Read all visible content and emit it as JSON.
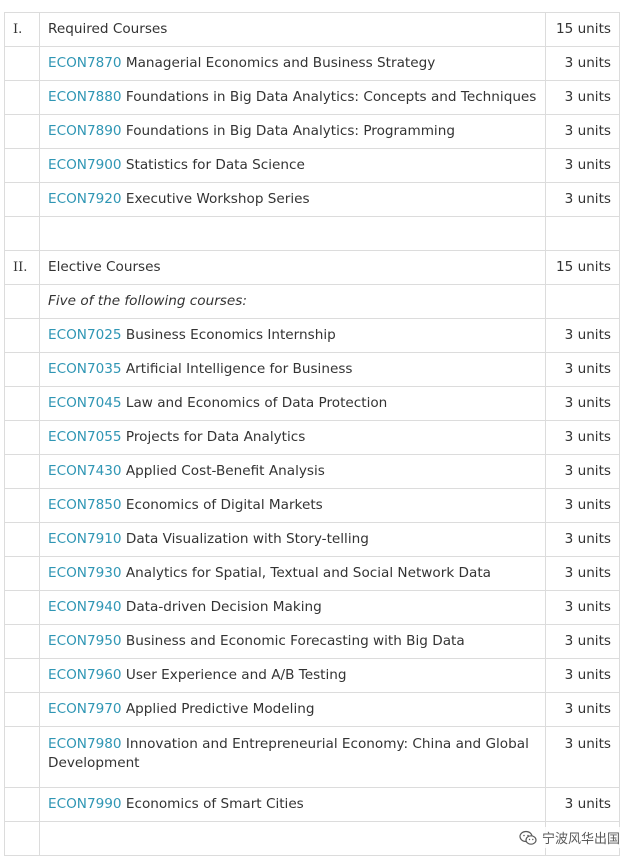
{
  "required": {
    "numeral": "I.",
    "title": "Required Courses",
    "units": "15 units",
    "courses": [
      {
        "code": "ECON7870",
        "name": "Managerial Economics and Business Strategy",
        "units": "3 units"
      },
      {
        "code": "ECON7880",
        "name": "Foundations in Big Data Analytics: Concepts and Techniques",
        "units": "3 units"
      },
      {
        "code": "ECON7890",
        "name": "Foundations in Big Data Analytics: Programming",
        "units": "3 units"
      },
      {
        "code": "ECON7900",
        "name": "Statistics for Data Science",
        "units": "3 units"
      },
      {
        "code": "ECON7920",
        "name": "Executive Workshop Series",
        "units": "3 units"
      }
    ]
  },
  "elective": {
    "numeral": "II.",
    "title": "Elective Courses",
    "units": "15 units",
    "note": "Five of the following courses:",
    "courses": [
      {
        "code": "ECON7025",
        "name": "Business Economics Internship",
        "units": "3 units"
      },
      {
        "code": "ECON7035",
        "name": "Artificial Intelligence for Business",
        "units": "3 units"
      },
      {
        "code": "ECON7045",
        "name": "Law and Economics of Data Protection",
        "units": "3 units"
      },
      {
        "code": "ECON7055",
        "name": "Projects for Data Analytics",
        "units": "3 units"
      },
      {
        "code": "ECON7430",
        "name": "Applied Cost-Benefit Analysis",
        "units": "3 units"
      },
      {
        "code": "ECON7850",
        "name": "Economics of Digital Markets",
        "units": "3 units"
      },
      {
        "code": "ECON7910",
        "name": "Data Visualization with Story-telling",
        "units": "3 units"
      },
      {
        "code": "ECON7930",
        "name": "Analytics for Spatial, Textual and Social Network Data",
        "units": "3 units"
      },
      {
        "code": "ECON7940",
        "name": "Data-driven Decision Making",
        "units": "3 units"
      },
      {
        "code": "ECON7950",
        "name": "Business and Economic Forecasting with Big Data",
        "units": "3 units"
      },
      {
        "code": "ECON7960",
        "name": "User Experience and A/B Testing",
        "units": "3 units"
      },
      {
        "code": "ECON7970",
        "name": "Applied Predictive Modeling",
        "units": "3 units"
      },
      {
        "code": "ECON7980",
        "name": "Innovation and Entrepreneurial Economy: China and Global Development",
        "units": "3 units"
      },
      {
        "code": "ECON7990",
        "name": "Economics of Smart Cities",
        "units": "3 units"
      }
    ]
  },
  "watermark": {
    "text": "宁波风华出国",
    "icon": "wechat-icon"
  },
  "colors": {
    "link": "#2f96b4",
    "border": "#dcdcdc",
    "text": "#333333"
  }
}
